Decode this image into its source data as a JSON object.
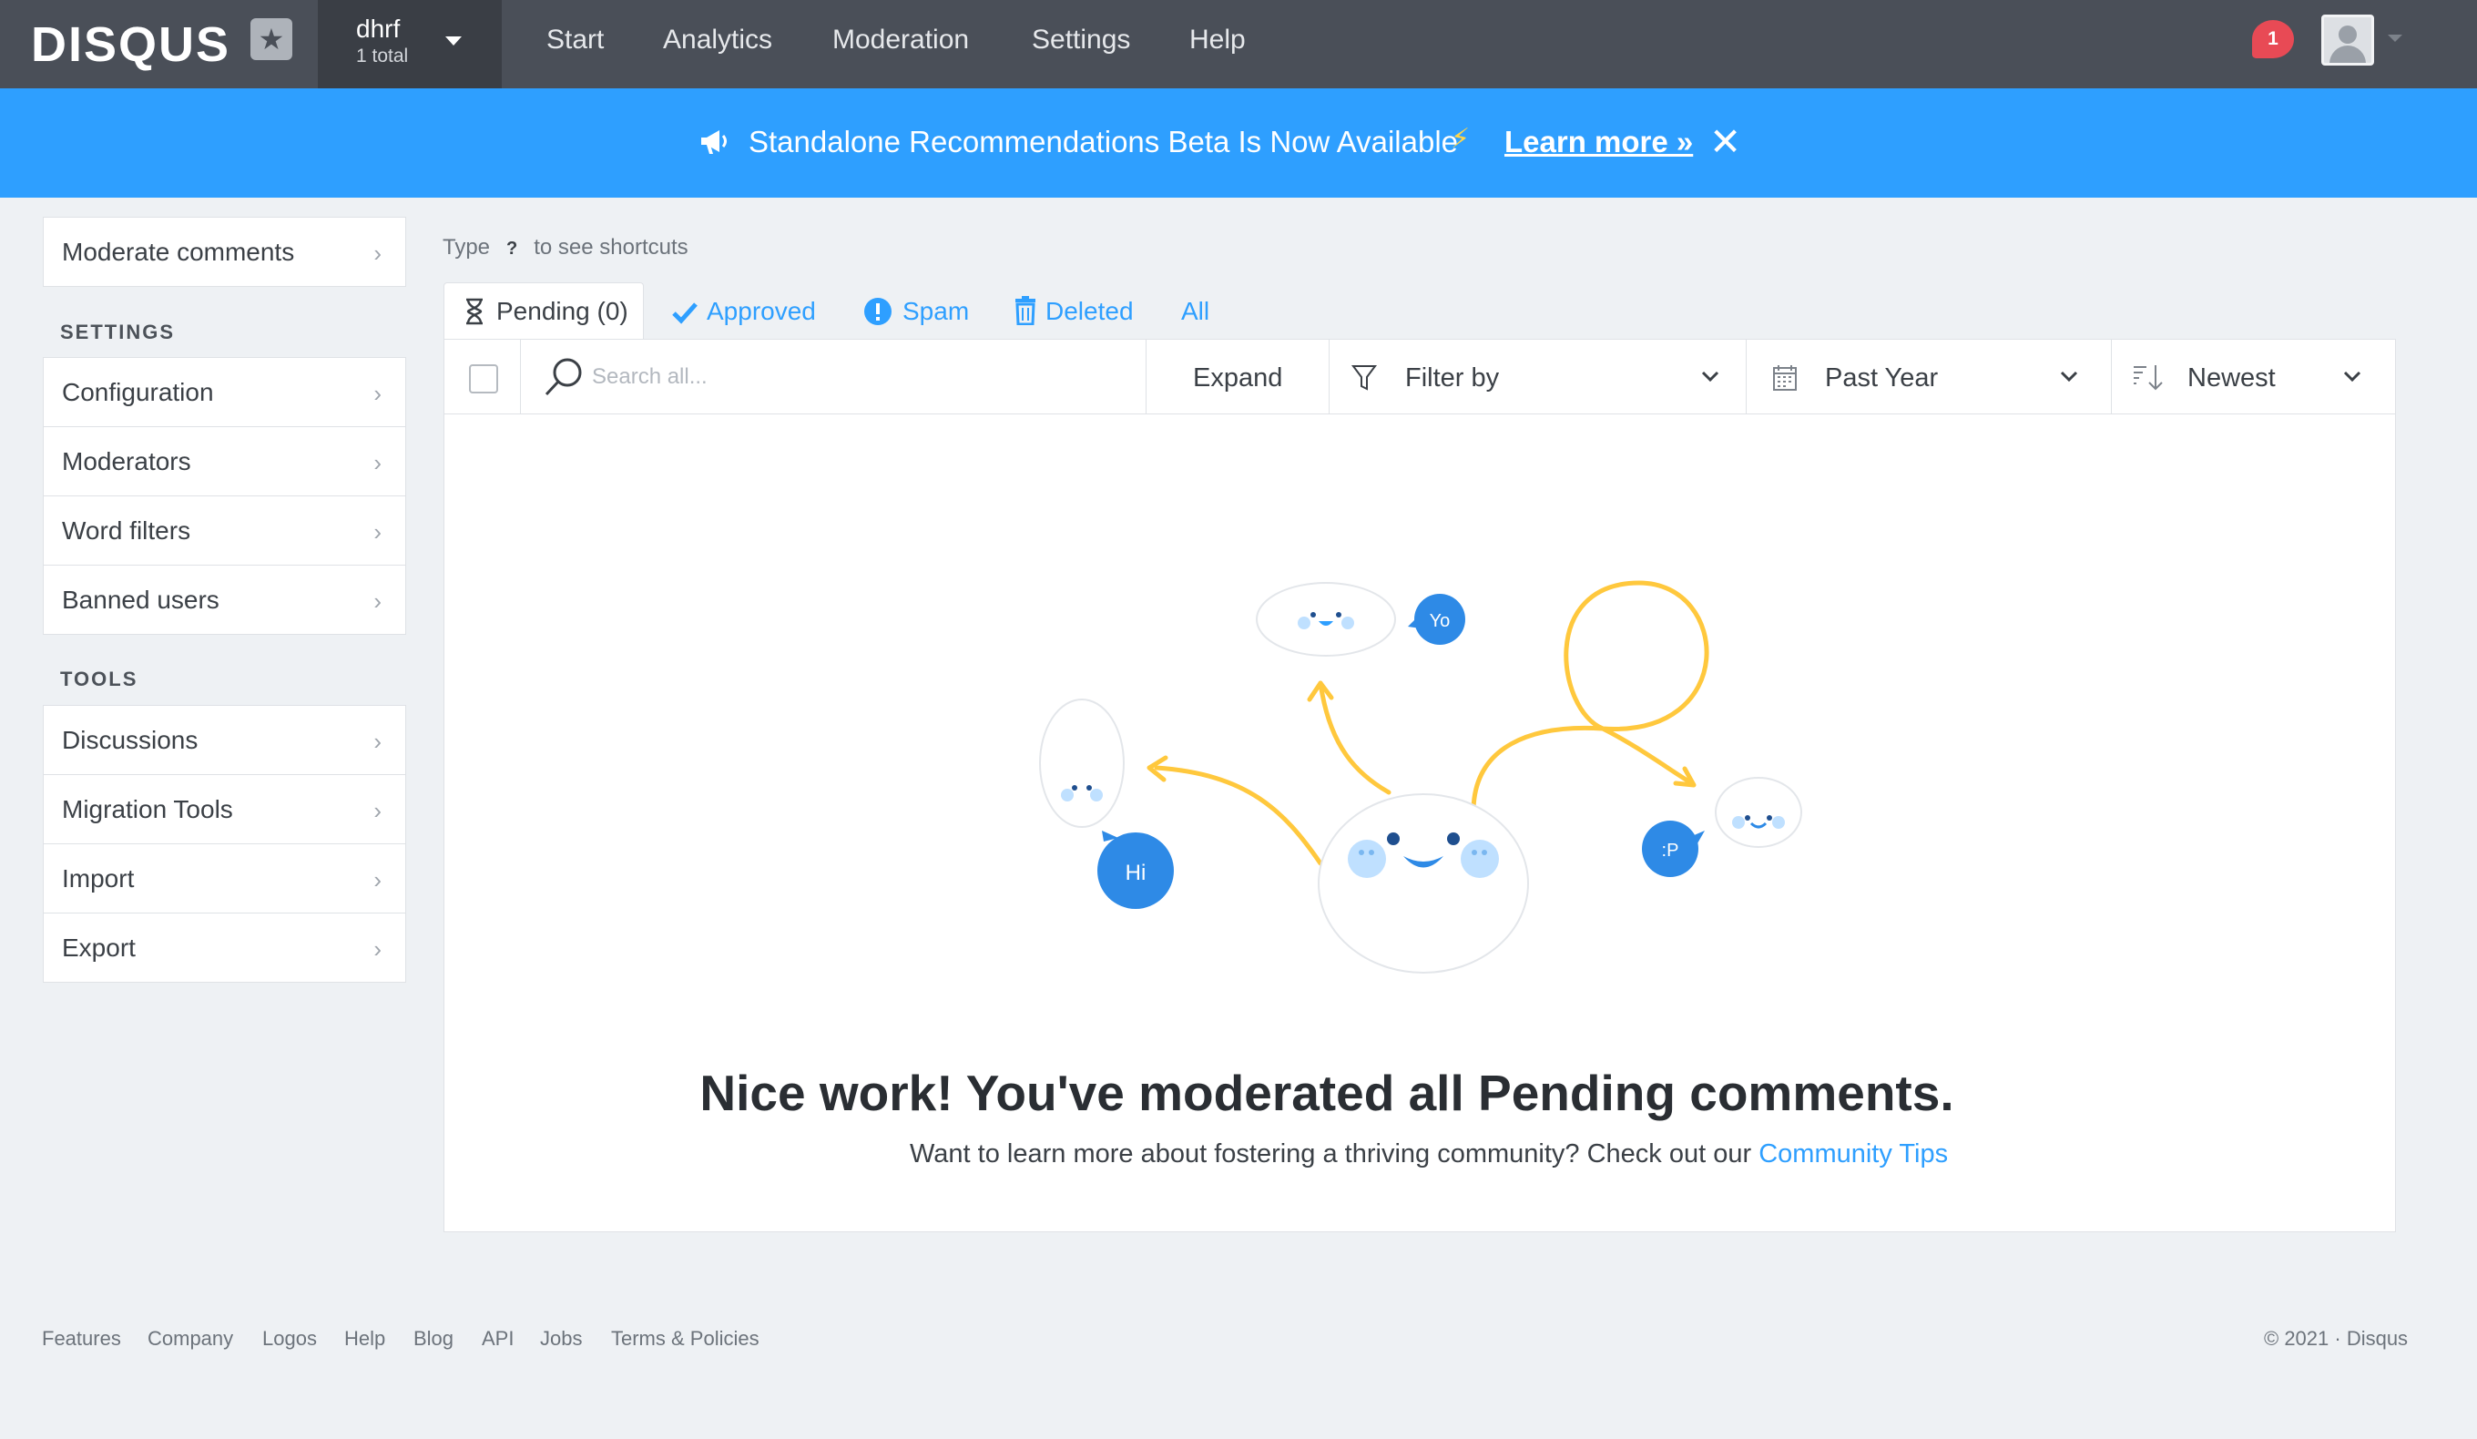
{
  "topbar": {
    "logo": "DISQUS",
    "site_name": "dhrf",
    "site_count": "1 total",
    "nav": [
      "Start",
      "Analytics",
      "Moderation",
      "Settings",
      "Help"
    ],
    "notification_count": "1"
  },
  "banner": {
    "text": "Standalone Recommendations Beta Is Now Available",
    "link": "Learn more »",
    "close": "✕",
    "bolt": "⚡"
  },
  "sidebar": {
    "moderate": "Moderate comments",
    "settings_heading": "SETTINGS",
    "settings_items": [
      "Configuration",
      "Moderators",
      "Word filters",
      "Banned users"
    ],
    "tools_heading": "TOOLS",
    "tools_items": [
      "Discussions",
      "Migration Tools",
      "Import",
      "Export"
    ]
  },
  "shortcut": {
    "prefix": "Type",
    "key": "?",
    "suffix": "to see shortcuts"
  },
  "tabs": {
    "pending": "Pending (0)",
    "approved": "Approved",
    "spam": "Spam",
    "deleted": "Deleted",
    "all": "All"
  },
  "toolbar": {
    "search_placeholder": "Search all...",
    "expand": "Expand",
    "filter": "Filter by",
    "date": "Past Year",
    "sort": "Newest"
  },
  "illustration": {
    "hi": "Hi",
    "yo": "Yo",
    "p": ":P"
  },
  "empty": {
    "title": "Nice work! You've moderated all Pending comments.",
    "subtitle": "Want to learn more about fostering a thriving community? Check out our",
    "link": "Community Tips"
  },
  "footer": {
    "links": [
      "Features",
      "Company",
      "Logos",
      "Help",
      "Blog",
      "API",
      "Jobs",
      "Terms & Policies"
    ],
    "copyright": "© 2021 · Disqus"
  },
  "colors": {
    "accent": "#2e9fff",
    "topbar": "#4a4f58",
    "notification": "#e84a55",
    "illustration_line": "#ffc83d"
  }
}
